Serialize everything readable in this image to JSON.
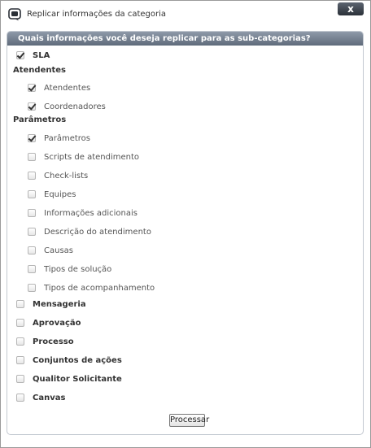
{
  "window": {
    "title": "Replicar informações da categoria",
    "close_label": "x"
  },
  "panel": {
    "header": "Quais informações você deseja replicar para as sub-categorias?"
  },
  "sla": {
    "label": "SLA",
    "checked": true
  },
  "sections": {
    "atendentes": "Atendentes",
    "parametros": "Parâmetros"
  },
  "atendentes_items": [
    {
      "label": "Atendentes",
      "checked": true
    },
    {
      "label": "Coordenadores",
      "checked": true
    }
  ],
  "parametros_items": [
    {
      "label": "Parâmetros",
      "checked": true
    },
    {
      "label": "Scripts de atendimento",
      "checked": false
    },
    {
      "label": "Check-lists",
      "checked": false
    },
    {
      "label": "Equipes",
      "checked": false
    },
    {
      "label": "Informações adicionais",
      "checked": false
    },
    {
      "label": "Descrição do atendimento",
      "checked": false
    },
    {
      "label": "Causas",
      "checked": false
    },
    {
      "label": "Tipos de solução",
      "checked": false
    },
    {
      "label": "Tipos de acompanhamento",
      "checked": false
    }
  ],
  "top_items": [
    {
      "label": "Mensageria",
      "checked": false
    },
    {
      "label": "Aprovação",
      "checked": false
    },
    {
      "label": "Processo",
      "checked": false
    },
    {
      "label": "Conjuntos de ações",
      "checked": false
    },
    {
      "label": "Qualitor Solicitante",
      "checked": false
    },
    {
      "label": "Canvas",
      "checked": false
    }
  ],
  "process_button": "Processar",
  "colors": {
    "header_bg": "#6f7b8b",
    "close_bg": "#3a4048",
    "check_color": "#333333"
  }
}
